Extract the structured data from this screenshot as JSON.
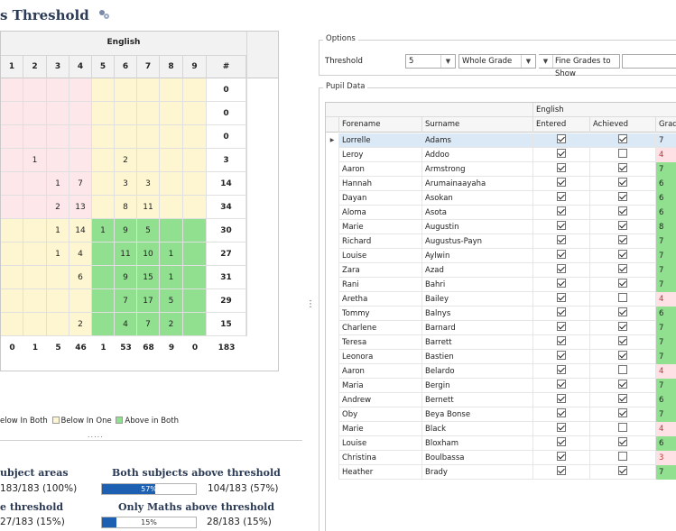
{
  "title": "s Threshold",
  "matrix": {
    "subject": "English",
    "col_headers": [
      "1",
      "2",
      "3",
      "4",
      "5",
      "6",
      "7",
      "8",
      "9",
      "#"
    ],
    "rows": [
      [
        "",
        "",
        "",
        "",
        "",
        "",
        "",
        "",
        "",
        "0"
      ],
      [
        "",
        "",
        "",
        "",
        "",
        "",
        "",
        "",
        "",
        "0"
      ],
      [
        "",
        "",
        "",
        "",
        "",
        "",
        "",
        "",
        "",
        "0"
      ],
      [
        "",
        "1",
        "",
        "",
        "",
        "2",
        "",
        "",
        "",
        "3"
      ],
      [
        "",
        "",
        "1",
        "7",
        "",
        "3",
        "3",
        "",
        "",
        "14"
      ],
      [
        "",
        "",
        "2",
        "13",
        "",
        "8",
        "11",
        "",
        "",
        "34"
      ],
      [
        "",
        "",
        "1",
        "14",
        "1",
        "9",
        "5",
        "",
        "",
        "30"
      ],
      [
        "",
        "",
        "1",
        "4",
        "",
        "11",
        "10",
        "1",
        "",
        "27"
      ],
      [
        "",
        "",
        "",
        "6",
        "",
        "9",
        "15",
        "1",
        "",
        "31"
      ],
      [
        "",
        "",
        "",
        "",
        "",
        "7",
        "17",
        "5",
        "",
        "29"
      ],
      [
        "",
        "",
        "",
        "2",
        "",
        "4",
        "7",
        "2",
        "",
        "15"
      ]
    ],
    "row_colors": [
      [
        "pink",
        "pink",
        "pink",
        "pink",
        "yellow",
        "yellow",
        "yellow",
        "yellow",
        "yellow"
      ],
      [
        "pink",
        "pink",
        "pink",
        "pink",
        "yellow",
        "yellow",
        "yellow",
        "yellow",
        "yellow"
      ],
      [
        "pink",
        "pink",
        "pink",
        "pink",
        "yellow",
        "yellow",
        "yellow",
        "yellow",
        "yellow"
      ],
      [
        "pink",
        "pink",
        "pink",
        "pink",
        "yellow",
        "yellow",
        "yellow",
        "yellow",
        "yellow"
      ],
      [
        "pink",
        "pink",
        "pink",
        "pink",
        "yellow",
        "yellow",
        "yellow",
        "yellow",
        "yellow"
      ],
      [
        "pink",
        "pink",
        "pink",
        "pink",
        "yellow",
        "yellow",
        "yellow",
        "yellow",
        "yellow"
      ],
      [
        "yellow",
        "yellow",
        "yellow",
        "yellow",
        "green",
        "green",
        "green",
        "green",
        "green"
      ],
      [
        "yellow",
        "yellow",
        "yellow",
        "yellow",
        "green",
        "green",
        "green",
        "green",
        "green"
      ],
      [
        "yellow",
        "yellow",
        "yellow",
        "yellow",
        "green",
        "green",
        "green",
        "green",
        "green"
      ],
      [
        "yellow",
        "yellow",
        "yellow",
        "yellow",
        "green",
        "green",
        "green",
        "green",
        "green"
      ],
      [
        "yellow",
        "yellow",
        "yellow",
        "yellow",
        "green",
        "green",
        "green",
        "green",
        "green"
      ]
    ],
    "totals": [
      "0",
      "1",
      "5",
      "46",
      "1",
      "53",
      "68",
      "9",
      "0",
      "183"
    ]
  },
  "legend": {
    "below_both": "elow In Both",
    "below_one": "Below In One",
    "above_both": "Above in Both",
    "dots": "....."
  },
  "stats": {
    "s1_title": "ubject areas",
    "s1_text": "183/183  (100%)",
    "s2_title": "Both subjects above threshold",
    "s2_bar_label": "57%",
    "s2_bar_percent": 57,
    "s2_text": "104/183  (57%)",
    "s3_title": "e threshold",
    "s3_text": "27/183  (15%)",
    "s4_title": "Only Maths above threshold",
    "s4_bar_label": "15%",
    "s4_bar_percent": 15,
    "s4_text": "28/183  (15%)"
  },
  "options": {
    "group_title": "Options",
    "threshold_label": "Threshold",
    "threshold_value": "5",
    "scope_value": "Whole Grade",
    "fine_label": "Fine Grades to Show",
    "fine_value": ""
  },
  "pupil_data": {
    "group_title": "Pupil Data",
    "subject": "English",
    "columns": [
      "Forename",
      "Surname",
      "Entered",
      "Achieved",
      "Grad"
    ],
    "rows": [
      {
        "forename": "Lorrelle",
        "surname": "Adams",
        "entered": true,
        "achieved": true,
        "grade": "7",
        "status": "selected"
      },
      {
        "forename": "Leroy",
        "surname": "Addoo",
        "entered": true,
        "achieved": false,
        "grade": "4",
        "status": "below"
      },
      {
        "forename": "Aaron",
        "surname": "Armstrong",
        "entered": true,
        "achieved": true,
        "grade": "7",
        "status": "above"
      },
      {
        "forename": "Hannah",
        "surname": "Arumainaayaha",
        "entered": true,
        "achieved": true,
        "grade": "6",
        "status": "above"
      },
      {
        "forename": "Dayan",
        "surname": "Asokan",
        "entered": true,
        "achieved": true,
        "grade": "6",
        "status": "above"
      },
      {
        "forename": "Aloma",
        "surname": "Asota",
        "entered": true,
        "achieved": true,
        "grade": "6",
        "status": "above"
      },
      {
        "forename": "Marie",
        "surname": "Augustin",
        "entered": true,
        "achieved": true,
        "grade": "8",
        "status": "above"
      },
      {
        "forename": "Richard",
        "surname": "Augustus-Payn",
        "entered": true,
        "achieved": true,
        "grade": "7",
        "status": "above"
      },
      {
        "forename": "Louise",
        "surname": "Aylwin",
        "entered": true,
        "achieved": true,
        "grade": "7",
        "status": "above"
      },
      {
        "forename": "Zara",
        "surname": "Azad",
        "entered": true,
        "achieved": true,
        "grade": "7",
        "status": "above"
      },
      {
        "forename": "Rani",
        "surname": "Bahri",
        "entered": true,
        "achieved": true,
        "grade": "7",
        "status": "above"
      },
      {
        "forename": "Aretha",
        "surname": "Bailey",
        "entered": true,
        "achieved": false,
        "grade": "4",
        "status": "below"
      },
      {
        "forename": "Tommy",
        "surname": "Balnys",
        "entered": true,
        "achieved": true,
        "grade": "6",
        "status": "above"
      },
      {
        "forename": "Charlene",
        "surname": "Barnard",
        "entered": true,
        "achieved": true,
        "grade": "7",
        "status": "above"
      },
      {
        "forename": "Teresa",
        "surname": "Barrett",
        "entered": true,
        "achieved": true,
        "grade": "7",
        "status": "above"
      },
      {
        "forename": "Leonora",
        "surname": "Bastien",
        "entered": true,
        "achieved": true,
        "grade": "7",
        "status": "above"
      },
      {
        "forename": "Aaron",
        "surname": "Belardo",
        "entered": true,
        "achieved": false,
        "grade": "4",
        "status": "below"
      },
      {
        "forename": "Maria",
        "surname": "Bergin",
        "entered": true,
        "achieved": true,
        "grade": "7",
        "status": "above"
      },
      {
        "forename": "Andrew",
        "surname": "Bernett",
        "entered": true,
        "achieved": true,
        "grade": "6",
        "status": "above"
      },
      {
        "forename": "Oby",
        "surname": "Beya Bonse",
        "entered": true,
        "achieved": true,
        "grade": "7",
        "status": "above"
      },
      {
        "forename": "Marie",
        "surname": "Black",
        "entered": true,
        "achieved": false,
        "grade": "4",
        "status": "below"
      },
      {
        "forename": "Louise",
        "surname": "Bloxham",
        "entered": true,
        "achieved": true,
        "grade": "6",
        "status": "above"
      },
      {
        "forename": "Christina",
        "surname": "Boulbassa",
        "entered": true,
        "achieved": false,
        "grade": "3",
        "status": "below"
      },
      {
        "forename": "Heather",
        "surname": "Brady",
        "entered": true,
        "achieved": true,
        "grade": "7",
        "status": "above"
      }
    ]
  },
  "colors": {
    "below_both": "#fde7ea",
    "below_one": "#fdf6d0",
    "above_both": "#90e090",
    "accent": "#1d5fb0"
  }
}
